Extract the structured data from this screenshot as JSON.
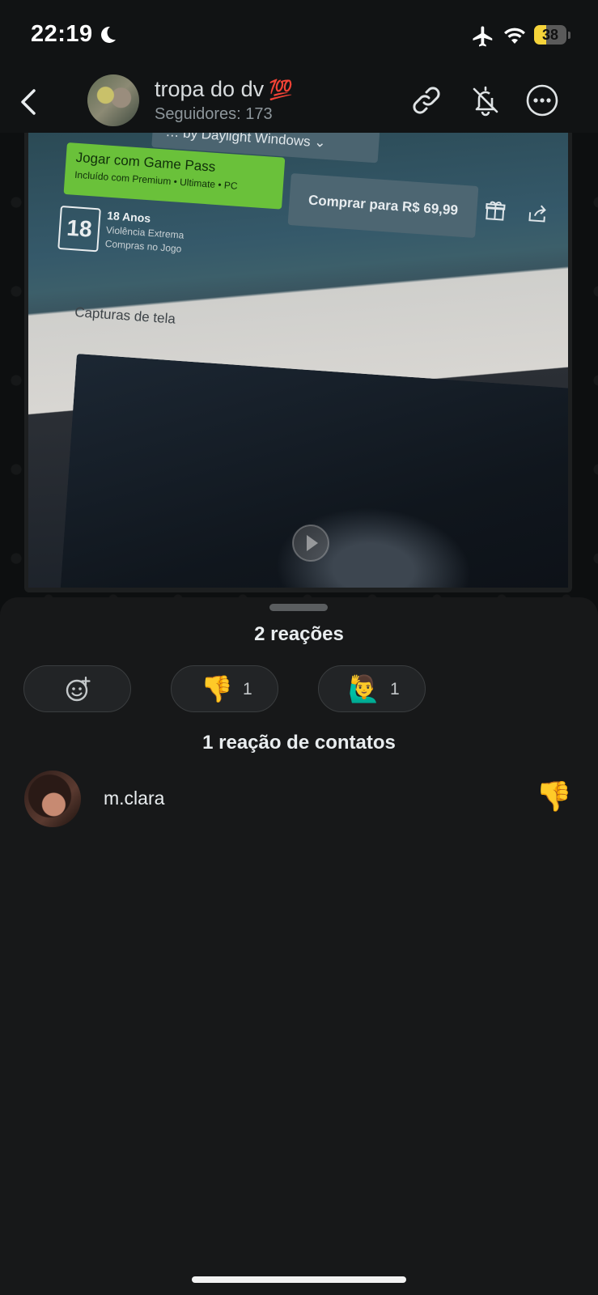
{
  "status_bar": {
    "time": "22:19",
    "battery": "38",
    "battery_level_percent": 38,
    "icons": [
      "moon-icon",
      "airplane-icon",
      "wifi-icon",
      "battery-icon"
    ]
  },
  "header": {
    "title": "tropa do dv",
    "title_emoji": "💯",
    "subtitle": "Seguidores: 173",
    "icons": [
      "back-icon",
      "link-icon",
      "bell-off-icon",
      "more-icon"
    ]
  },
  "media": {
    "dropdown_text": "… by Daylight Windows ⌄",
    "gamepass_title": "Jogar com Game Pass",
    "gamepass_sub": "Incluído com Premium • Ultimate • PC",
    "buy_label": "Comprar para R$ 69,99",
    "rating_number": "18",
    "rating_title": "18 Anos",
    "rating_line1": "Violência Extrema",
    "rating_line2": "Compras no Jogo",
    "captures_label": "Capturas de tela"
  },
  "sheet": {
    "title": "2 reações",
    "chips": [
      {
        "name": "add-reaction",
        "emoji": "",
        "count": ""
      },
      {
        "name": "thumbs-down",
        "emoji": "👎",
        "count": "1"
      },
      {
        "name": "raising-hand",
        "emoji": "🙋‍♂️",
        "count": "1"
      }
    ],
    "contacts_title": "1 reação de contatos",
    "reactions": [
      {
        "user": "m.clara",
        "emoji": "👎"
      }
    ]
  },
  "colors": {
    "background": "#171819",
    "accent_battery": "#f5d33a",
    "gamepass_green": "#6ac13a"
  }
}
